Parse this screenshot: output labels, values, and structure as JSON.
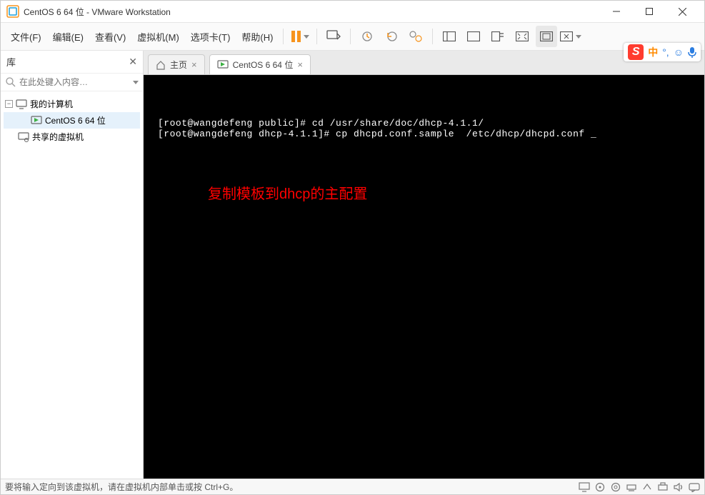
{
  "title": "CentOS 6 64 位 - VMware Workstation",
  "menu": {
    "file": "文件(F)",
    "edit": "编辑(E)",
    "view": "查看(V)",
    "vm": "虚拟机(M)",
    "tabs": "选项卡(T)",
    "help": "帮助(H)"
  },
  "sidebar": {
    "title": "库",
    "search_placeholder": "在此处键入内容…",
    "nodes": {
      "root": "我的计算机",
      "child": "CentOS 6 64 位",
      "shared": "共享的虚拟机"
    }
  },
  "tabs": {
    "home": "主页",
    "vm": "CentOS 6 64 位"
  },
  "terminal": {
    "line1": "[root@wangdefeng public]# cd /usr/share/doc/dhcp-4.1.1/",
    "line2": "[root@wangdefeng dhcp-4.1.1]# cp dhcpd.conf.sample  /etc/dhcp/dhcpd.conf _",
    "annotation": "复制模板到dhcp的主配置"
  },
  "statusbar": {
    "text": "要将输入定向到该虚拟机，请在虚拟机内部单击或按 Ctrl+G。"
  },
  "ime": {
    "s": "S",
    "cn": "中"
  }
}
